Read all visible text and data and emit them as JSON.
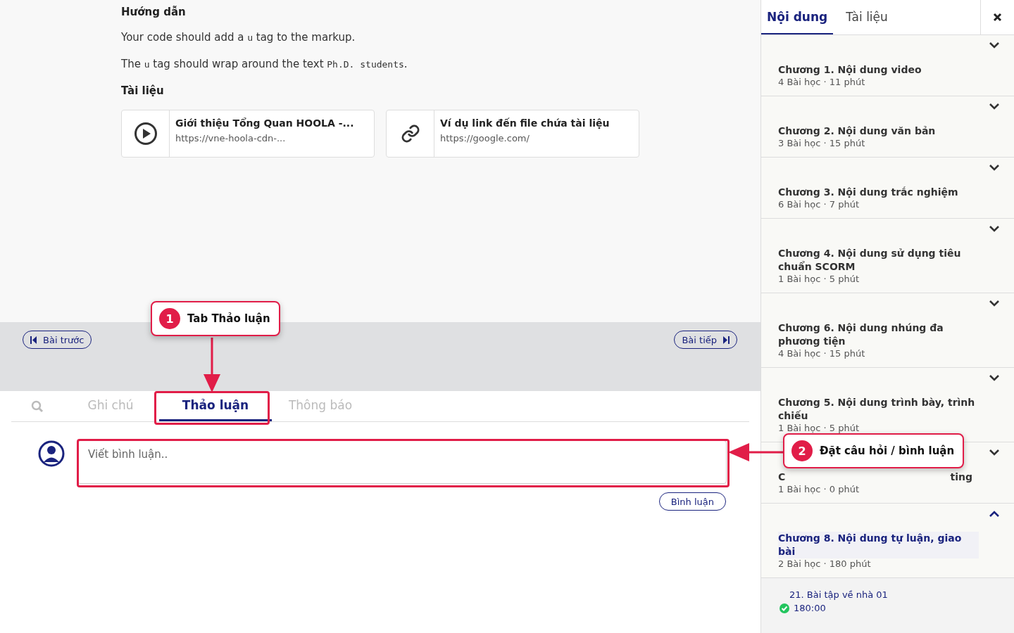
{
  "instructions": {
    "heading": "Hướng dẫn",
    "paragraphs": [
      [
        {
          "text": "Your code should add a ",
          "code": false
        },
        {
          "text": "u",
          "code": true
        },
        {
          "text": " tag to the markup.",
          "code": false
        }
      ],
      [
        {
          "text": "The ",
          "code": false
        },
        {
          "text": "u",
          "code": true
        },
        {
          "text": " tag should wrap around the text ",
          "code": false
        },
        {
          "text": "Ph.D. students",
          "code": true
        },
        {
          "text": ".",
          "code": false
        }
      ]
    ]
  },
  "documents": {
    "heading": "Tài liệu",
    "items": [
      {
        "kind": "video",
        "title": "Giới thiệu Tổng Quan HOOLA -...",
        "url": "https://vne-hoola-cdn-..."
      },
      {
        "kind": "link",
        "title": "Ví dụ link đến file chứa tài liệu",
        "url": "https://google.com/"
      }
    ]
  },
  "nav": {
    "previous": "Bài trước",
    "next": "Bài tiếp"
  },
  "tabs": [
    {
      "label": "Ghi chú",
      "selected": false
    },
    {
      "label": "Thảo luận",
      "selected": true
    },
    {
      "label": "Thông báo",
      "selected": false
    }
  ],
  "comment": {
    "placeholder": "Viết bình luận..",
    "submit": "Bình luận"
  },
  "callouts": [
    {
      "number": "1",
      "text": "Tab Thảo luận"
    },
    {
      "number": "2",
      "text": "Đặt câu hỏi / bình luận"
    }
  ],
  "sidebar": {
    "tabs": [
      {
        "label": "Nội dung",
        "selected": true
      },
      {
        "label": "Tài liệu",
        "selected": false
      }
    ],
    "chapters": [
      {
        "title": "Chương 1. Nội dung video",
        "meta": "4 Bài học · 11 phút",
        "expanded": false
      },
      {
        "title": "Chương 2. Nội dung văn bản",
        "meta": "3 Bài học · 15 phút",
        "expanded": false
      },
      {
        "title": "Chương 3. Nội dung trắc nghiệm",
        "meta": "6 Bài học · 7 phút",
        "expanded": false
      },
      {
        "title": "Chương 4. Nội dung sử dụng tiêu chuẩn SCORM",
        "meta": "1 Bài học · 5 phút",
        "expanded": false
      },
      {
        "title": "Chương 6. Nội dung nhúng đa phương tiện",
        "meta": "4 Bài học · 15 phút",
        "expanded": false
      },
      {
        "title": "Chương 5. Nội dung trình bày, trình chiếu",
        "meta": "1 Bài học · 5 phút",
        "expanded": false
      },
      {
        "title_fragments": [
          "C",
          "ting"
        ],
        "meta": "1 Bài học · 0 phút",
        "expanded": false
      },
      {
        "title": "Chương 8. Nội dung tự luận, giao bài",
        "meta": "2 Bài học · 180 phút",
        "expanded": true,
        "lessons": [
          {
            "title": "21. Bài tập về nhà 01",
            "duration": "180:00",
            "done": true
          }
        ]
      }
    ]
  }
}
